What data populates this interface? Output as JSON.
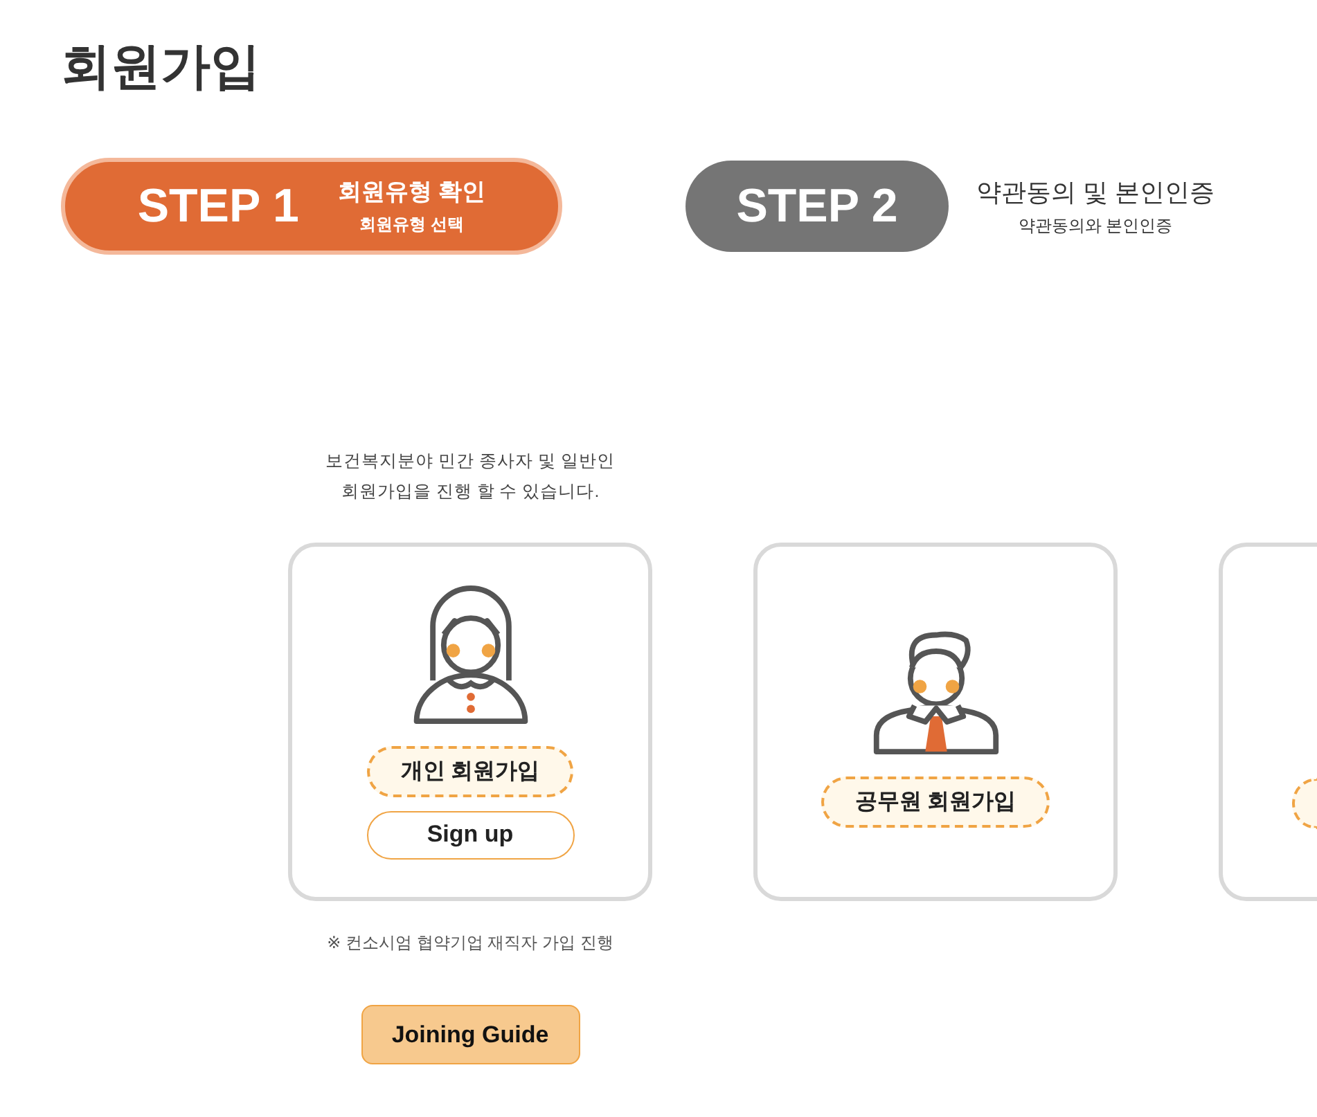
{
  "page_title": "회원가입",
  "steps": [
    {
      "number": "STEP 1",
      "title": "회원유형 확인",
      "subtitle": "회원유형 선택",
      "selected": true
    },
    {
      "number": "STEP 2",
      "title": "약관동의 및 본인인증",
      "subtitle": "약관동의와 본인인증",
      "selected": false
    }
  ],
  "member_types": [
    {
      "kind": "woman",
      "description": "보건복지분야 민간 종사자 및 일반인\n회원가입을 진행 할 수 있습니다.",
      "label": "개인 회원가입",
      "button": "Sign up",
      "note": "※ 컨소시엄 협약기업 재직자 가입 진행",
      "guide_button": "Joining Guide"
    },
    {
      "kind": "man",
      "label": "공무원 회원가입"
    },
    {
      "kind": "cut"
    }
  ]
}
